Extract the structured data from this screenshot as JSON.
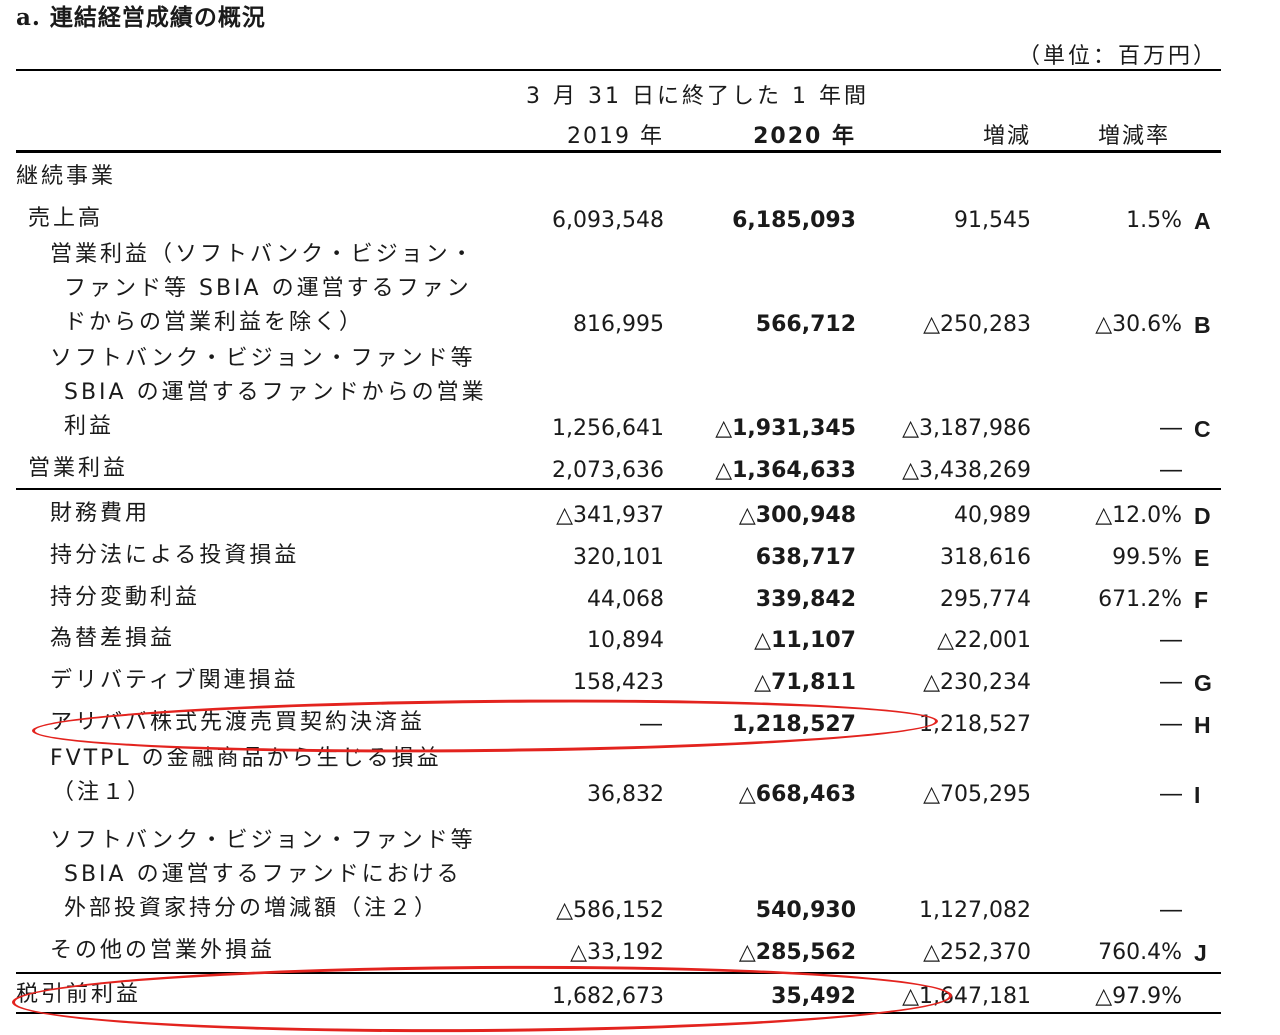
{
  "title": "a. 連結経営成績の概況",
  "unit": "（単位：百万円）",
  "header": {
    "period": "3 月 31 日に終了した 1 年間",
    "col_2019": "2019 年",
    "col_2020": "2020 年",
    "col_diff": "増減",
    "col_rate": "増減率"
  },
  "section_label": "継続事業",
  "rows": [
    {
      "lines": [
        "売上高"
      ],
      "v2019": "6,093,548",
      "v2020": "6,185,093",
      "diff": "91,545",
      "rate": "1.5%",
      "mark": "A"
    },
    {
      "lines": [
        "営業利益（ソフトバンク・ビジョン・",
        "ファンド等 SBIA の運営するファン",
        "ドからの営業利益を除く）"
      ],
      "v2019": "816,995",
      "v2020": "566,712",
      "diff": "△250,283",
      "rate": "△30.6%",
      "mark": "B"
    },
    {
      "lines": [
        "ソフトバンク・ビジョン・ファンド等",
        "SBIA の運営するファンドからの営業",
        "利益"
      ],
      "v2019": "1,256,641",
      "v2020": "△1,931,345",
      "diff": "△3,187,986",
      "rate": "―",
      "mark": "C"
    },
    {
      "lines": [
        "営業利益"
      ],
      "v2019": "2,073,636",
      "v2020": "△1,364,633",
      "diff": "△3,438,269",
      "rate": "―",
      "mark": ""
    },
    {
      "lines": [
        "財務費用"
      ],
      "v2019": "△341,937",
      "v2020": "△300,948",
      "diff": "40,989",
      "rate": "△12.0%",
      "mark": "D"
    },
    {
      "lines": [
        "持分法による投資損益"
      ],
      "v2019": "320,101",
      "v2020": "638,717",
      "diff": "318,616",
      "rate": "99.5%",
      "mark": "E"
    },
    {
      "lines": [
        "持分変動利益"
      ],
      "v2019": "44,068",
      "v2020": "339,842",
      "diff": "295,774",
      "rate": "671.2%",
      "mark": "F"
    },
    {
      "lines": [
        "為替差損益"
      ],
      "v2019": "10,894",
      "v2020": "△11,107",
      "diff": "△22,001",
      "rate": "―",
      "mark": ""
    },
    {
      "lines": [
        "デリバティブ関連損益"
      ],
      "v2019": "158,423",
      "v2020": "△71,811",
      "diff": "△230,234",
      "rate": "―",
      "mark": "G"
    },
    {
      "lines": [
        "アリババ株式先渡売買契約決済益"
      ],
      "v2019": "―",
      "v2020": "1,218,527",
      "diff": "1,218,527",
      "rate": "―",
      "mark": "H"
    },
    {
      "lines": [
        "FVTPL の金融商品から生じる損益",
        "（注１）"
      ],
      "v2019": "36,832",
      "v2020": "△668,463",
      "diff": "△705,295",
      "rate": "―",
      "mark": "I"
    },
    {
      "lines": [
        "ソフトバンク・ビジョン・ファンド等",
        "SBIA の運営するファンドにおける",
        "外部投資家持分の増減額（注２）"
      ],
      "v2019": "△586,152",
      "v2020": "540,930",
      "diff": "1,127,082",
      "rate": "―",
      "mark": ""
    },
    {
      "lines": [
        "その他の営業外損益"
      ],
      "v2019": "△33,192",
      "v2020": "△285,562",
      "diff": "△252,370",
      "rate": "760.4%",
      "mark": "J"
    },
    {
      "lines": [
        "税引前利益"
      ],
      "v2019": "1,682,673",
      "v2020": "35,492",
      "diff": "△1,647,181",
      "rate": "△97.9%",
      "mark": ""
    }
  ],
  "annotation_color": "#e3231e"
}
